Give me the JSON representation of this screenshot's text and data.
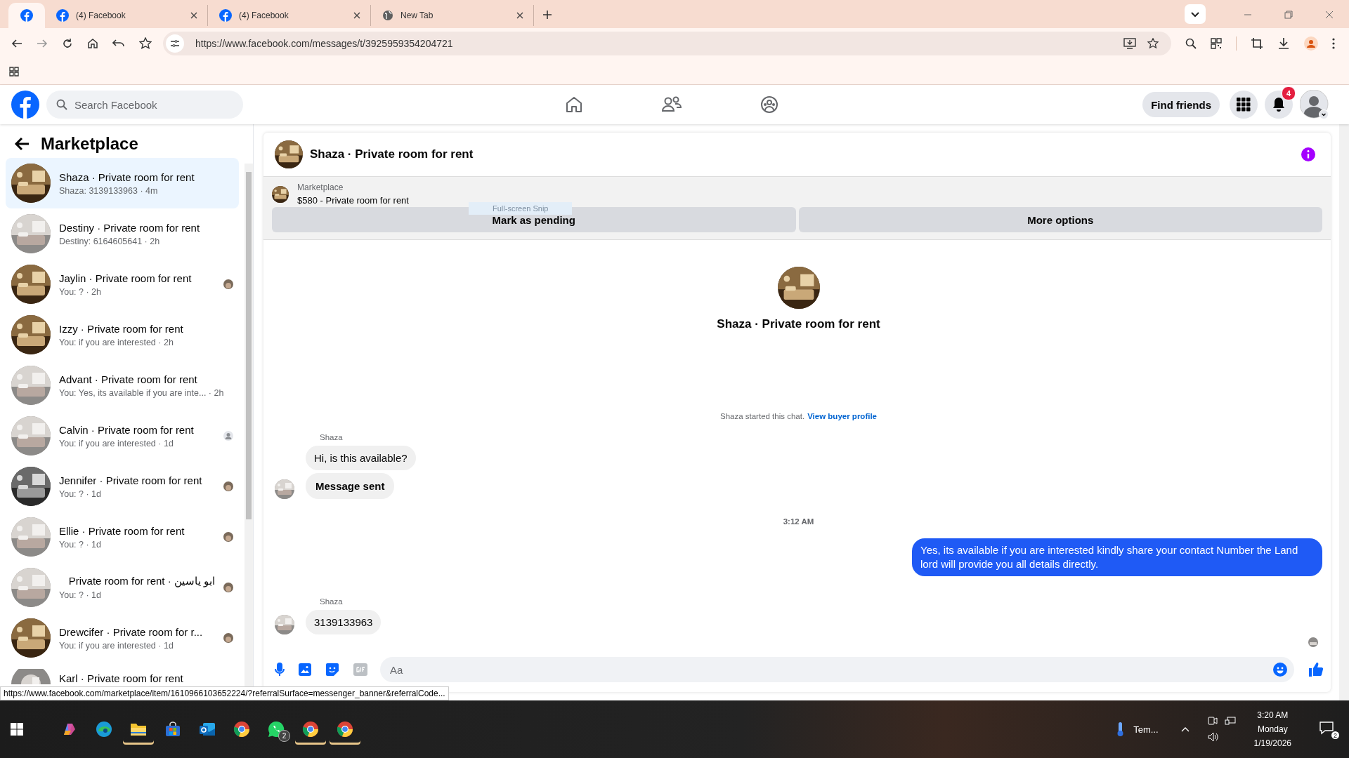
{
  "browser": {
    "tabs": [
      {
        "selected": true,
        "kind": "site"
      },
      {
        "label": "(4) Facebook",
        "selected": false,
        "kind": "site"
      },
      {
        "label": "(4) Facebook",
        "selected": false,
        "kind": "site"
      },
      {
        "label": "New Tab",
        "selected": false,
        "kind": "blank"
      }
    ],
    "url": "https://www.facebook.com/messages/t/3925959354204721"
  },
  "header": {
    "search": {
      "placeholder": "Search Facebook"
    },
    "find_friends": "Find friends",
    "notification_count": "4"
  },
  "sidebar": {
    "title": "Marketplace",
    "conversations": [
      {
        "title": "Shaza · Private room for rent",
        "preview": "Shaza: 3139133963 · 4m",
        "selected": true
      },
      {
        "title": "Destiny · Private room for rent",
        "preview": "Destiny: 6164605641 · 2h",
        "selected": false
      },
      {
        "title": "Jaylin · Private room for rent",
        "preview": "You: ? · 2h",
        "selected": false
      },
      {
        "title": "Izzy · Private room for rent",
        "preview": "You: if you are interested · 2h",
        "selected": false
      },
      {
        "title": "Advant · Private room for rent",
        "preview": "You: Yes, its available if you are inte... · 2h",
        "selected": false
      },
      {
        "title": "Calvin · Private room for rent",
        "preview": "You: if you are interested · 1d",
        "selected": false,
        "seen": {
          "kind": "default"
        }
      },
      {
        "title": "Jennifer · Private room for rent",
        "preview": "You: ? · 1d",
        "selected": false
      },
      {
        "title": "Ellie · Private room for rent",
        "preview": "You: ? · 1d",
        "selected": false
      },
      {
        "title": "ابو ياسين · Private room for rent",
        "preview": "You: ? · 1d",
        "selected": false
      },
      {
        "title": "Drewcifer · Private room for r...",
        "preview": "You: if you are interested · 1d",
        "selected": false
      },
      {
        "title": "Karl · Private room for rent",
        "selected": false
      }
    ]
  },
  "chat": {
    "title": "Shaza · Private room for rent",
    "listing": {
      "source": "Marketplace",
      "item": "$580 - Private room for rent",
      "snip_tooltip": "Full-screen Snip",
      "buttons": [
        "Mark as pending",
        "More options"
      ]
    },
    "profile_title": "Shaza · Private room for rent",
    "started": "Shaza started this chat.",
    "started_link": "View buyer profile",
    "messages": [
      {
        "kind": "sender",
        "text": "Shaza"
      },
      {
        "kind": "incoming",
        "text": "Hi, is this available?",
        "emphasis": false
      },
      {
        "kind": "incoming",
        "text": "Message sent",
        "avatar": true,
        "emphasis": true
      },
      {
        "kind": "time",
        "text": "3:12 AM"
      },
      {
        "kind": "outgoing",
        "text": "Yes, its available if you are interested kindly share your contact Number the Land lord will provide you all details directly."
      },
      {
        "kind": "sender",
        "text": "Shaza"
      },
      {
        "kind": "incoming",
        "text": "3139133963",
        "avatar": true,
        "emphasis": false
      },
      {
        "kind": "seen"
      }
    ],
    "composer": {
      "placeholder": "Aa"
    }
  },
  "status_url": "https://www.facebook.com/marketplace/item/1610966103652224/?referralSurface=messenger_banner&referralCode...",
  "taskbar": {
    "apps": [
      {
        "kind": "copilot",
        "running": false
      },
      {
        "kind": "edge",
        "running": false
      },
      {
        "kind": "folder",
        "running": true
      },
      {
        "kind": "store",
        "running": false
      },
      {
        "kind": "mail",
        "running": false
      },
      {
        "kind": "chrome",
        "running": false
      },
      {
        "kind": "whatsapp",
        "running": false,
        "badge": "2"
      },
      {
        "kind": "chrome",
        "running": true
      },
      {
        "kind": "chrome",
        "running": true
      }
    ],
    "weather": "Tem...",
    "time": "3:20 AM",
    "day": "Monday",
    "date": "1/19/2026",
    "notifications": "2"
  }
}
